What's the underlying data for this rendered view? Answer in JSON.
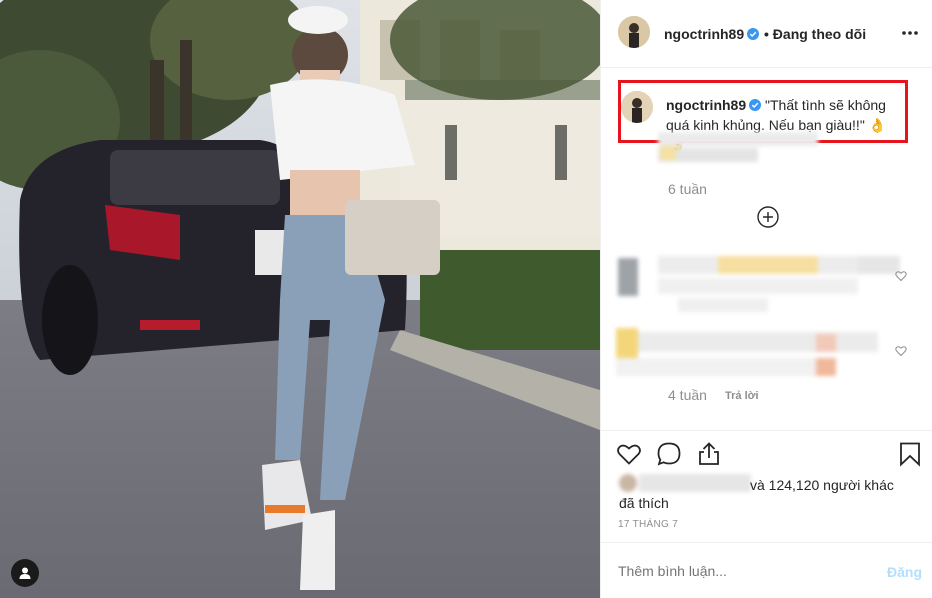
{
  "post": {
    "username": "ngoctrinh89",
    "follow_status": "Đang theo dõi",
    "caption_text": "\"Thất tình sẽ không quá kinh khủng. Nếu bạn giàu!!\" 👌😌",
    "comments": [
      {
        "time": "6 tuần"
      },
      {
        "time": ""
      },
      {
        "time": "4 tuần",
        "reply_label": "Trả lời"
      }
    ],
    "likes_text": "và 124,120 người khác",
    "likes_suffix": "đã thích",
    "date": "17 THÁNG 7",
    "comment_placeholder": "Thêm bình luận...",
    "post_label": "Đăng"
  },
  "icons": {
    "verified": "verified-badge-icon",
    "more": "more-horizontal-icon",
    "add": "plus-circle-icon",
    "like": "heart-icon",
    "comment": "comment-bubble-icon",
    "share": "share-icon",
    "save": "bookmark-icon",
    "user_tag": "user-tag-icon"
  },
  "colors": {
    "accent_blue": "#3897f0",
    "highlight_red": "#e8141b",
    "muted_text": "#8e8e8e"
  }
}
